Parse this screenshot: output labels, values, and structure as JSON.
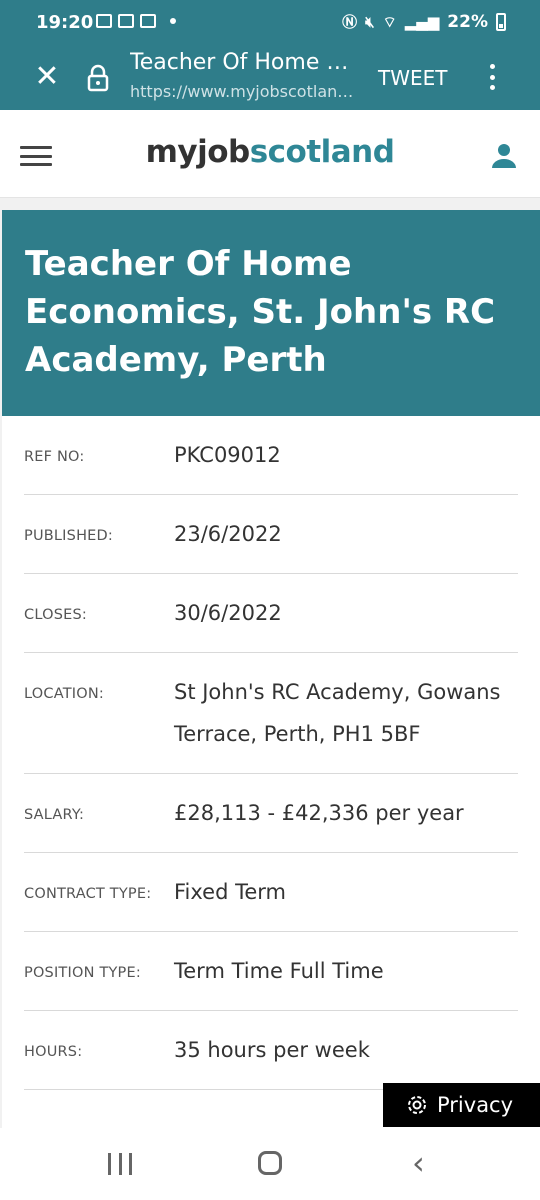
{
  "status_bar": {
    "time": "19:20",
    "battery": "22%"
  },
  "browser": {
    "page_title": "Teacher Of Home Economics, St. John's RC Academy, Perth",
    "url": "https://www.myjobscotland.gov.uk",
    "tweet_label": "TWEET"
  },
  "site": {
    "logo_part1": "myjob",
    "logo_part2": "scotland"
  },
  "job": {
    "title": "Teacher Of Home Economics, St. John's RC Academy, Perth",
    "details": [
      {
        "label": "REF NO:",
        "value": "PKC09012"
      },
      {
        "label": "PUBLISHED:",
        "value": "23/6/2022"
      },
      {
        "label": "CLOSES:",
        "value": "30/6/2022"
      },
      {
        "label": "LOCATION:",
        "value": "St John's RC Academy, Gowans Terrace, Perth, PH1 5BF"
      },
      {
        "label": "SALARY:",
        "value": "£28,113 - £42,336 per year"
      },
      {
        "label": "CONTRACT TYPE:",
        "value": "Fixed Term"
      },
      {
        "label": "POSITION TYPE:",
        "value": "Term Time Full Time"
      },
      {
        "label": "HOURS:",
        "value": "35 hours per week"
      }
    ]
  },
  "privacy": {
    "label": "Privacy"
  },
  "colors": {
    "primary_teal": "#2f7d8a",
    "logo_accent": "#2f8796"
  }
}
